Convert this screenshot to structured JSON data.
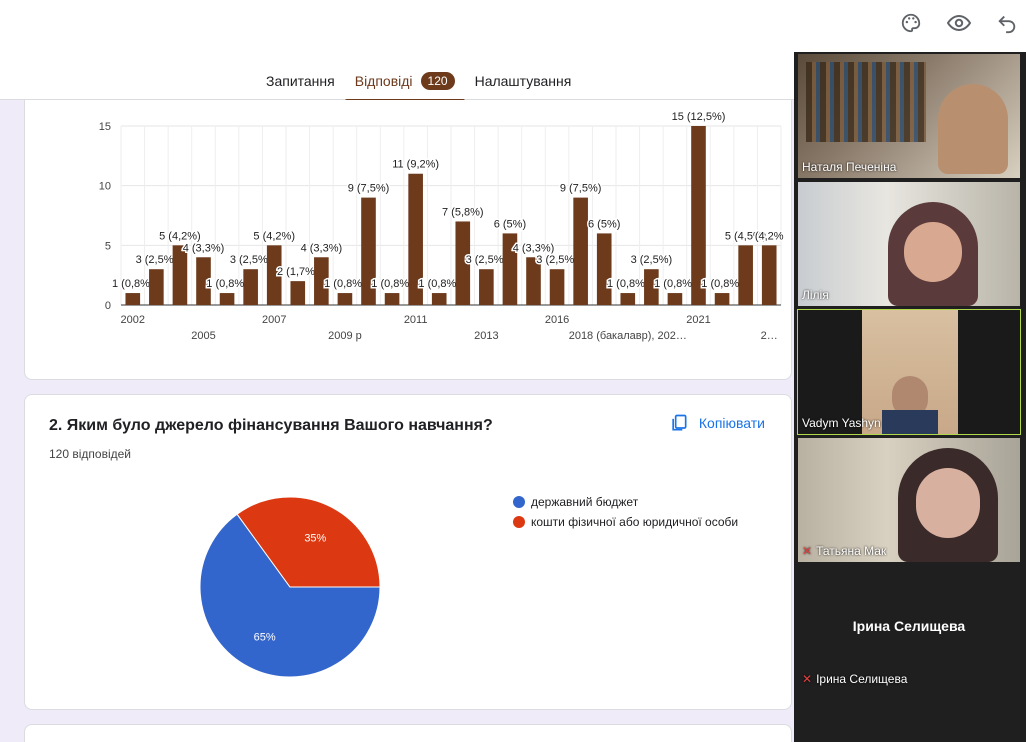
{
  "tabs": [
    {
      "label": "Запитання"
    },
    {
      "label": "Відповіді",
      "badge": "120"
    },
    {
      "label": "Налаштування"
    }
  ],
  "toolbar_icons": [
    "palette-icon",
    "eye-icon",
    "undo-icon"
  ],
  "accent": "#6d3a1c",
  "chart_data": [
    {
      "type": "bar",
      "bar_color": "#6d3a1c",
      "ylim": [
        0,
        15
      ],
      "yticks": [
        0,
        5,
        10,
        15
      ],
      "values": [
        1,
        3,
        5,
        4,
        1,
        3,
        5,
        2,
        4,
        1,
        9,
        1,
        11,
        1,
        7,
        3,
        6,
        4,
        3,
        9,
        6,
        1,
        3,
        1,
        15,
        1,
        5,
        5
      ],
      "data_labels": [
        "1 (0,8%)",
        "3 (2,5%)",
        "5 (4,2%)",
        "4 (3,3%)",
        "1 (0,8%)",
        "3 (2,5%)",
        "5 (4,2%)",
        "2 (1,7%)",
        "4 (3,3%)",
        "1 (0,8%)",
        "9 (7,5%)",
        "1 (0,8%)",
        "11 (9,2%)",
        "1 (0,8%)",
        "7 (5,8%)",
        "3 (2,5%)",
        "6 (5%)",
        "4 (3,3%)",
        "3 (2,5%)",
        "9 (7,5%)",
        "6 (5%)",
        "1 (0,8%)",
        "3 (2,5%)",
        "1 (0,8%)",
        "15 (12,5%)",
        "1 (0,8%)",
        "5 (4,5%)",
        "(4,2%"
      ],
      "x_tick_labels": [
        {
          "index": 0,
          "label": "2002",
          "row": 1
        },
        {
          "index": 3,
          "label": "2005",
          "row": 2
        },
        {
          "index": 6,
          "label": "2007",
          "row": 1
        },
        {
          "index": 9,
          "label": "2009 р",
          "row": 2
        },
        {
          "index": 12,
          "label": "2011",
          "row": 1
        },
        {
          "index": 15,
          "label": "2013",
          "row": 2
        },
        {
          "index": 18,
          "label": "2016",
          "row": 1
        },
        {
          "index": 21,
          "label": "2018 (бакалавр), 202…",
          "row": 2
        },
        {
          "index": 24,
          "label": "2021",
          "row": 1
        },
        {
          "index": 27,
          "label": "2…",
          "row": 2
        }
      ]
    },
    {
      "type": "pie",
      "question": "2. Яким було джерело фінансування Вашого навчання?",
      "responses": "120 відповідей",
      "copy_label": "Копіювати",
      "slices": [
        {
          "name": "державний бюджет",
          "value": 65,
          "label": "65%",
          "color": "#3366cc"
        },
        {
          "name": "кошти фізичної або юридичної особи",
          "value": 35,
          "label": "35%",
          "color": "#dc3912"
        }
      ]
    }
  ],
  "participants": [
    {
      "name": "Наталя Печеніна",
      "muted": false
    },
    {
      "name": "Лілія",
      "muted": false
    },
    {
      "name": "Vadym Yashyn",
      "muted": false
    },
    {
      "name": "Татьяна Мак",
      "muted": true
    },
    {
      "name": "Ірина Селищева",
      "muted": true,
      "title": "Ірина Селищева"
    }
  ]
}
